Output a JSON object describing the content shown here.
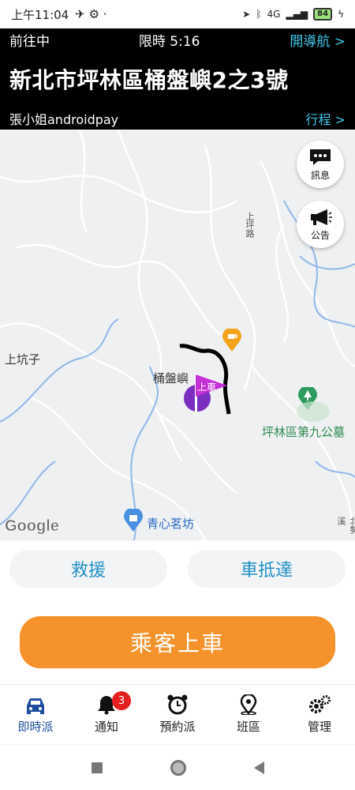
{
  "statusbar": {
    "time": "上午11:04",
    "signal": "4G",
    "battery": "84"
  },
  "header": {
    "status": "前往中",
    "timer": "限時 5:16",
    "navigate": "開導航 >",
    "address": "新北市坪林區桶盤嶼2之3號",
    "passenger": "張小姐androidpay",
    "trip": "行程 >"
  },
  "map": {
    "labels": {
      "place_left": "上坑子",
      "place_center": "桶盤嶼",
      "road_vertical": "上坪路",
      "cemetery": "坪林區第九公墓",
      "shop": "青心茗坊",
      "road_right": "北勢溪"
    },
    "pickup_marker": "上車",
    "fab_message": "訊息",
    "fab_announce": "公告",
    "attribution": "Google"
  },
  "actions": {
    "rescue": "救援",
    "arrived": "車抵達",
    "board": "乘客上車"
  },
  "tabs": [
    {
      "label": "即時派",
      "icon": "car-icon"
    },
    {
      "label": "通知",
      "icon": "bell-icon",
      "badge": "3"
    },
    {
      "label": "預約派",
      "icon": "alarm-clock-icon"
    },
    {
      "label": "班區",
      "icon": "location-pin-icon"
    },
    {
      "label": "管理",
      "icon": "gears-icon"
    }
  ],
  "colors": {
    "accent_blue": "#3ec7e8",
    "primary_orange": "#f5922b",
    "badge_red": "#e51f1f",
    "active_tab": "#1d4e9e"
  }
}
